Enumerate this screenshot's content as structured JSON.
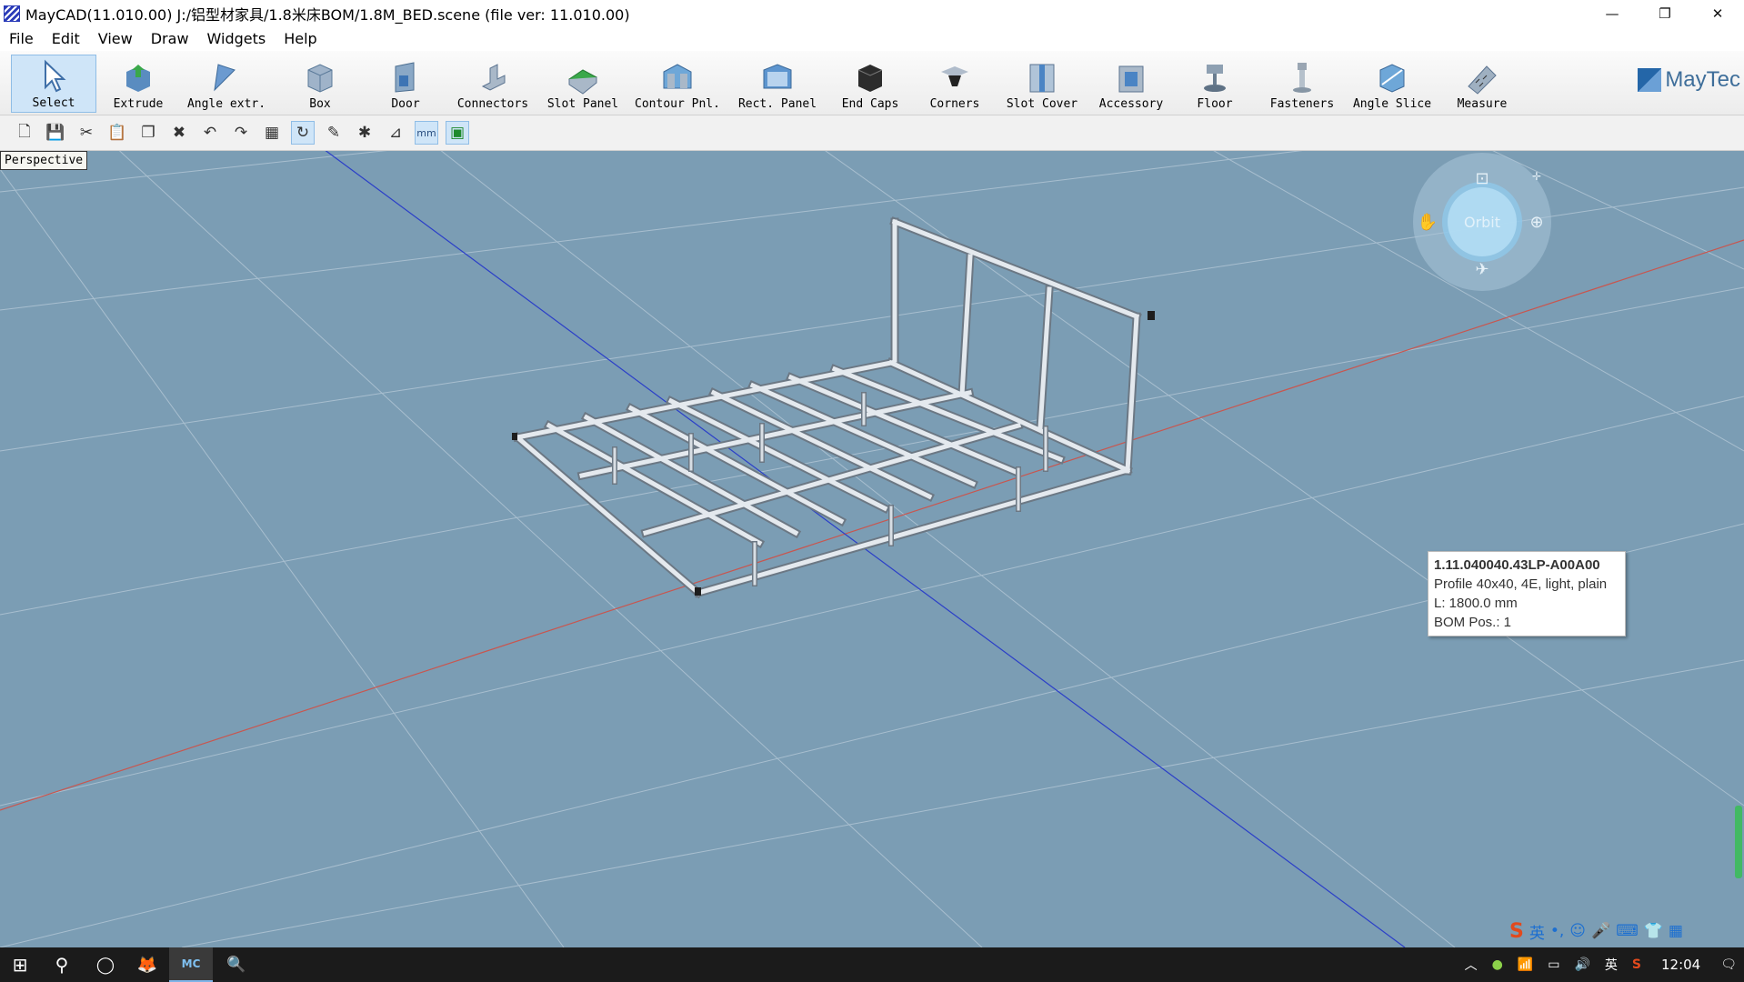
{
  "window": {
    "title": "MayCAD(11.010.00) J:/铝型材家具/1.8米床BOM/1.8M_BED.scene (file ver: 11.010.00)",
    "minimize_glyph": "—",
    "restore_glyph": "❐",
    "close_glyph": "✕"
  },
  "menu": [
    "File",
    "Edit",
    "View",
    "Draw",
    "Widgets",
    "Help"
  ],
  "ribbon": {
    "tools": [
      {
        "label": "Select",
        "icon": "select-cursor-icon",
        "active": true
      },
      {
        "label": "Extrude",
        "icon": "extrude-icon"
      },
      {
        "label": "Angle extr.",
        "icon": "angle-extrude-icon"
      },
      {
        "label": "Box",
        "icon": "box-icon"
      },
      {
        "label": "Door",
        "icon": "door-icon"
      },
      {
        "label": "Connectors",
        "icon": "connectors-icon"
      },
      {
        "label": "Slot Panel",
        "icon": "slot-panel-icon"
      },
      {
        "label": "Contour Pnl.",
        "icon": "contour-panel-icon"
      },
      {
        "label": "Rect. Panel",
        "icon": "rect-panel-icon"
      },
      {
        "label": "End Caps",
        "icon": "end-caps-icon"
      },
      {
        "label": "Corners",
        "icon": "corners-icon"
      },
      {
        "label": "Slot Cover",
        "icon": "slot-cover-icon"
      },
      {
        "label": "Accessory",
        "icon": "accessory-icon"
      },
      {
        "label": "Floor",
        "icon": "floor-icon"
      },
      {
        "label": "Fasteners",
        "icon": "fasteners-icon"
      },
      {
        "label": "Angle Slice",
        "icon": "angle-slice-icon"
      },
      {
        "label": "Measure",
        "icon": "measure-icon"
      }
    ],
    "logo_text": "MayTec"
  },
  "iconbar": {
    "buttons": [
      {
        "name": "new-file-icon",
        "glyph": "🗋"
      },
      {
        "name": "save-icon",
        "glyph": "💾"
      },
      {
        "name": "cut-icon",
        "glyph": "✂"
      },
      {
        "name": "paste-icon",
        "glyph": "📋"
      },
      {
        "name": "copy-icon",
        "glyph": "❐"
      },
      {
        "name": "delete-icon",
        "glyph": "✖"
      },
      {
        "name": "undo-icon",
        "glyph": "↶"
      },
      {
        "name": "redo-icon",
        "glyph": "↷"
      },
      {
        "name": "grid-select-icon",
        "glyph": "▦"
      },
      {
        "name": "rotate-icon",
        "glyph": "↻",
        "pressed": true
      },
      {
        "name": "edit-properties-icon",
        "glyph": "✎"
      },
      {
        "name": "bug-icon",
        "glyph": "✱"
      },
      {
        "name": "dimension-icon",
        "glyph": "⊿"
      },
      {
        "name": "units-mm-icon",
        "glyph": "mm",
        "pressed": true
      },
      {
        "name": "green-blocks-icon",
        "glyph": "▣",
        "pressed": true
      }
    ]
  },
  "viewport": {
    "view_label": "Perspective",
    "navcube_center_label": "Orbit",
    "background_color": "#7b9db4",
    "grid_color": "#b7cad8",
    "axis_x_color": "#c8564f",
    "axis_y_color": "#2b3fc8"
  },
  "tooltip": {
    "part_number": "1.11.040040.43LP-A00A00",
    "description": "Profile 40x40, 4E, light, plain",
    "length": "L: 1800.0 mm",
    "bom_pos": "BOM Pos.: 1"
  },
  "ime_bar": {
    "logo": "S",
    "lang": "英",
    "punct": "•,",
    "emoji": "☺",
    "mic": "🎤",
    "keyboard": "⌨",
    "extra1": "👕",
    "extra2": "▦"
  },
  "taskbar": {
    "start": "⊞",
    "search": "⚲",
    "apps": [
      {
        "name": "cortana-icon",
        "glyph": "◯"
      },
      {
        "name": "firefox-icon",
        "glyph": "🦊"
      },
      {
        "name": "maycad-taskbar-icon",
        "glyph": "MC",
        "active": true
      },
      {
        "name": "search-app-icon",
        "glyph": "🔍"
      }
    ],
    "tray": {
      "chevron": "︿",
      "ime_lang": "英",
      "clock": "12:04",
      "notification": "🗨"
    }
  }
}
